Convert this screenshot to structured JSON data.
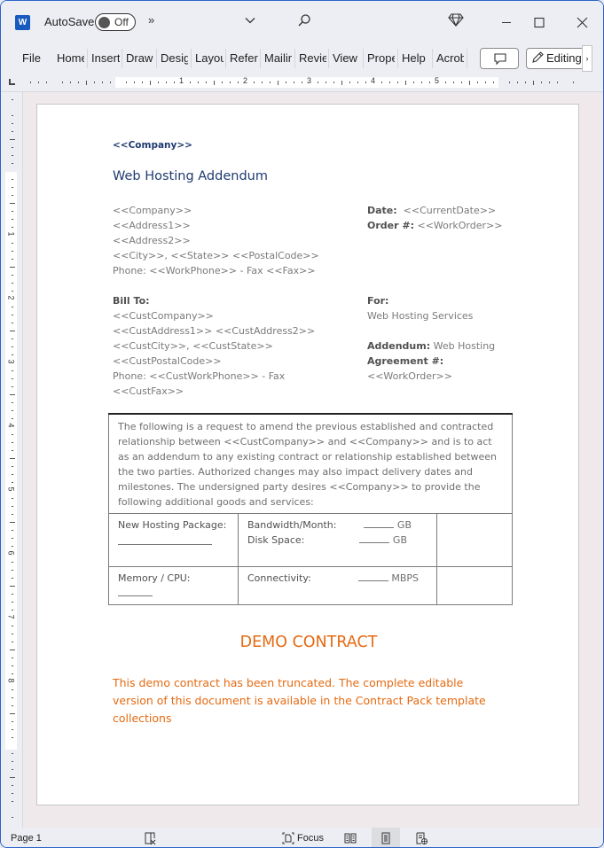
{
  "titlebar": {
    "app_icon": "word-icon",
    "app_icon_letter": "W",
    "autosave_label": "AutoSave",
    "autosave_state": "Off",
    "overflow_icon": "chevron-double-right-icon",
    "overflow_glyph": "»",
    "qa_dropdown_icon": "chevron-down-icon",
    "search_icon": "search-icon",
    "premium_icon": "diamond-icon",
    "window_controls": [
      "minimize",
      "maximize",
      "close"
    ]
  },
  "ribbon": {
    "tabs": [
      {
        "label": "File"
      },
      {
        "label": "Home"
      },
      {
        "label": "Insert"
      },
      {
        "label": "Draw"
      },
      {
        "label": "Design"
      },
      {
        "label": "Layout"
      },
      {
        "label": "References"
      },
      {
        "label": "Mailings"
      },
      {
        "label": "Review"
      },
      {
        "label": "View"
      },
      {
        "label": "Properties"
      },
      {
        "label": "Help"
      },
      {
        "label": "Acrobat"
      }
    ],
    "comment_icon": "comment-icon",
    "editing_label": "Editing",
    "scroll_glyph": "›"
  },
  "ruler": {
    "horizontal_numbers": [
      "1",
      "2",
      "3",
      "4",
      "5"
    ],
    "vertical_numbers": [
      "1",
      "2",
      "3",
      "4",
      "5",
      "6",
      "7",
      "8"
    ]
  },
  "document": {
    "company_header": "<<Company>>",
    "title": "Web Hosting Addendum",
    "sender_address": [
      "<<Company>>",
      "<<Address1>>",
      "<<Address2>>",
      "<<City>>, <<State>>  <<PostalCode>>",
      "Phone: <<WorkPhone>>  - Fax <<Fax>>"
    ],
    "date_label": "Date:",
    "date_value": "<<CurrentDate>>",
    "order_label": "Order #:",
    "order_value": "<<WorkOrder>>",
    "bill_to_label": "Bill To:",
    "bill_to_lines": [
      "<<CustCompany>>",
      "<<CustAddress1>> <<CustAddress2>>",
      "<<CustCity>>, <<CustState>>",
      "<<CustPostalCode>>",
      "Phone: <<CustWorkPhone>>  - Fax",
      "<<CustFax>>"
    ],
    "for_label": "For:",
    "for_value": "Web Hosting Services",
    "addendum_label": "Addendum:",
    "addendum_value": "Web Hosting",
    "agreement_label": "Agreement #:",
    "agreement_value": "<<WorkOrder>>",
    "table": {
      "intro": "The following is a request to amend the previous established and contracted relationship between <<CustCompany>> and <<Company>> and is to act as an addendum to any existing contract or relationship established between the two parties. Authorized changes may also impact delivery dates and milestones. The undersigned party desires <<Company>> to provide the following additional goods and services:",
      "row1": {
        "col1_label": "New Hosting Package:",
        "bandwidth_label": "Bandwidth/Month:",
        "bandwidth_unit": "GB",
        "disk_label": "Disk Space:",
        "disk_unit": "GB"
      },
      "row2": {
        "col1_label": "Memory / CPU:",
        "connectivity_label": "Connectivity:",
        "connectivity_unit": "MBPS"
      }
    },
    "demo_title": "DEMO CONTRACT",
    "demo_text": "This demo contract has been truncated. The complete editable version of this document is available in the Contract Pack template collections"
  },
  "statusbar": {
    "page_label": "Page 1",
    "proofing_icon": "proofing-icon",
    "focus_label": "Focus",
    "views": [
      "read-mode-icon",
      "print-layout-icon",
      "web-layout-icon"
    ],
    "active_view": "print-layout"
  },
  "colors": {
    "heading_blue": "#1f3a70",
    "demo_orange": "#e56a12",
    "body_gray": "#7a7a7a",
    "window_border": "#2b63c9"
  }
}
